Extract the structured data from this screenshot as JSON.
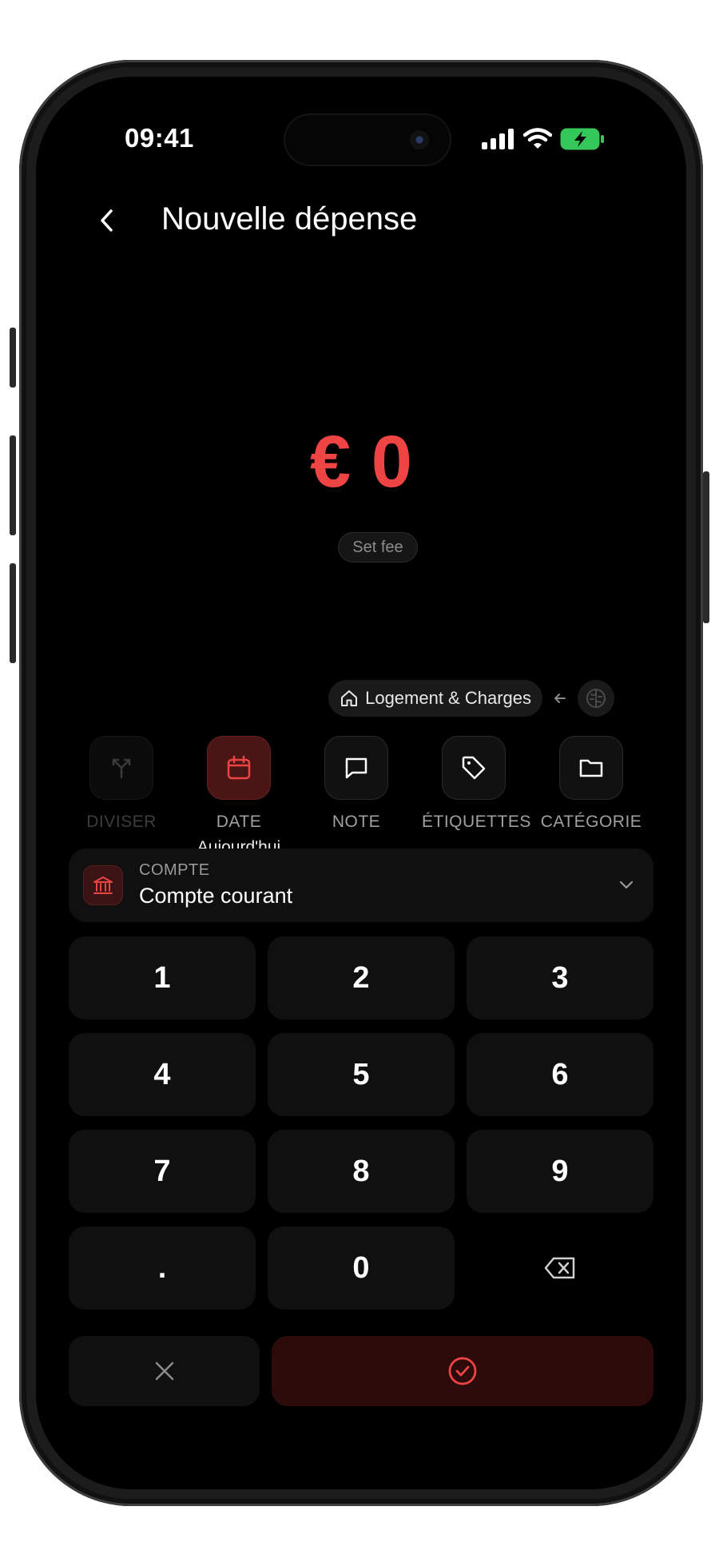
{
  "status_bar": {
    "time": "09:41"
  },
  "header": {
    "title": "Nouvelle dépense"
  },
  "amount": {
    "display": "€ 0",
    "fee_label": "Set fee"
  },
  "category": {
    "label": "Logement & Charges"
  },
  "actions": [
    {
      "label": "DIVISER",
      "sub": ""
    },
    {
      "label": "DATE",
      "sub": "Aujourd'hui"
    },
    {
      "label": "NOTE",
      "sub": ""
    },
    {
      "label": "ÉTIQUETTES",
      "sub": ""
    },
    {
      "label": "CATÉGORIE",
      "sub": ""
    }
  ],
  "account": {
    "key": "COMPTE",
    "value": "Compte courant"
  },
  "keypad": [
    "1",
    "2",
    "3",
    "4",
    "5",
    "6",
    "7",
    "8",
    "9",
    ".",
    "0"
  ],
  "colors": {
    "accent": "#ef4444",
    "background": "#000000",
    "surface": "#101010"
  },
  "icons": {
    "back": "chevron-left-icon",
    "category": "home-icon",
    "ai": "brain-icon",
    "split": "split-arrows-icon",
    "date": "calendar-icon",
    "note": "message-square-icon",
    "tags": "tag-icon",
    "folder": "folder-icon",
    "account": "bank-icon",
    "delete": "backspace-icon",
    "cancel": "close-icon",
    "confirm": "check-circle-icon"
  }
}
